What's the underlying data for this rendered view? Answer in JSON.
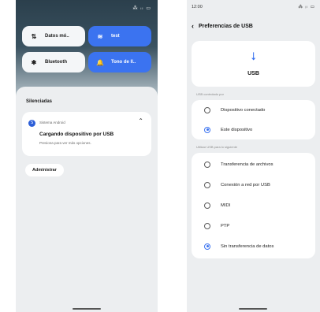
{
  "left_screen": {
    "status_icons": "⁂ ᵢₗ ▭",
    "tiles": [
      {
        "label": "Datos mó..",
        "icon": "data-arrows-icon",
        "glyph": "⇅",
        "active": false
      },
      {
        "label": "test",
        "icon": "wifi-icon",
        "glyph": "≋",
        "active": true
      },
      {
        "label": "Bluetooth",
        "icon": "bluetooth-icon",
        "glyph": "✱",
        "active": false
      },
      {
        "label": "Tono de ll..",
        "icon": "bell-icon",
        "glyph": "🔔",
        "active": true
      }
    ],
    "silenced_header": "Silenciadas",
    "notification": {
      "app_badge": "S",
      "app_name": "Sistema Android",
      "chevron": "⌃",
      "title": "Cargando dispositivo por USB",
      "subtitle": "Presiona para ver más opciones."
    },
    "manage_button": "Administrar"
  },
  "right_screen": {
    "time": "12:00",
    "status_icons": "⁂ ᵢₗ ▭",
    "back_glyph": "‹",
    "title": "Preferencias de USB",
    "usb_glyph": "⭣",
    "usb_label": "USB",
    "section1_label": "USB controlado por",
    "section1_options": [
      {
        "label": "Dispositivo conectado",
        "selected": false
      },
      {
        "label": "Este dispositivo",
        "selected": true
      }
    ],
    "section2_label": "Utilizar USB para lo siguiente",
    "section2_options": [
      {
        "label": "Transferencia de archivos",
        "selected": false
      },
      {
        "label": "Conexión a red por USB",
        "selected": false
      },
      {
        "label": "MIDI",
        "selected": false
      },
      {
        "label": "PTP",
        "selected": false
      },
      {
        "label": "Sin transferencia de datos",
        "selected": true
      }
    ]
  },
  "colors": {
    "accent": "#3b73f0",
    "tile_light": "#f4f6f8",
    "sheet_bg": "#eceef0"
  }
}
